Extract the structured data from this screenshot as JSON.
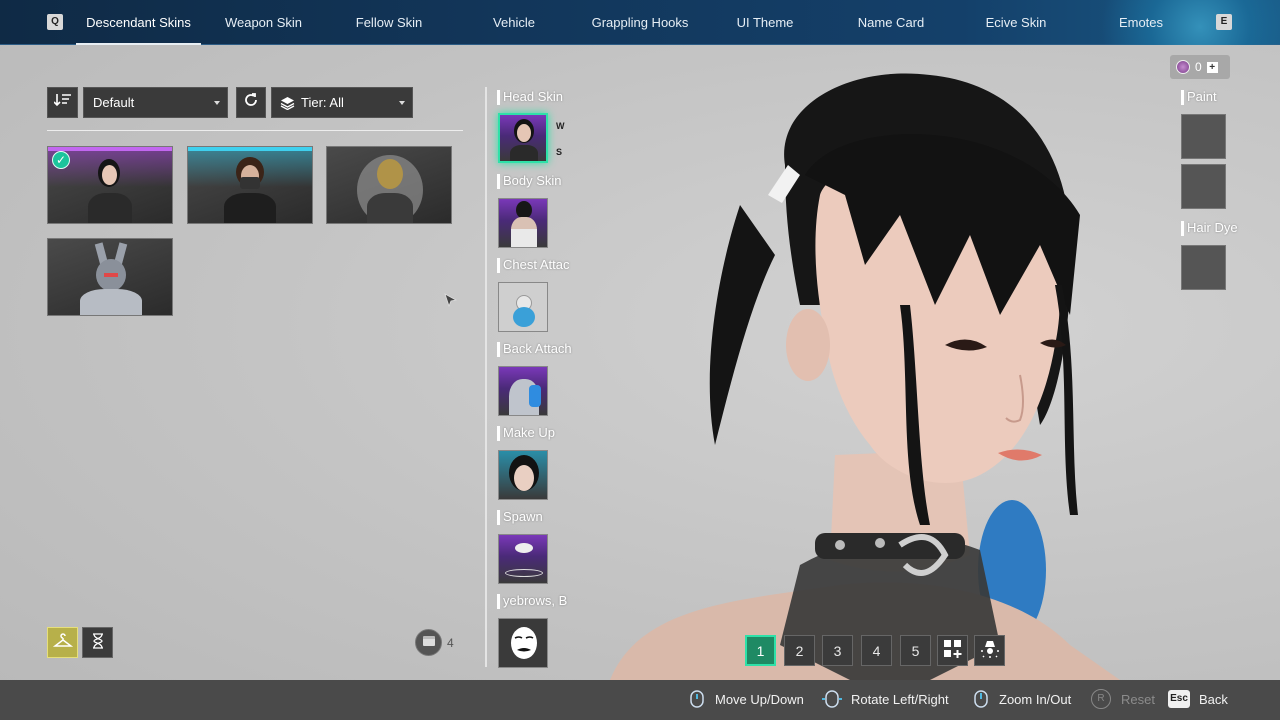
{
  "nav": {
    "prev_key": "Q",
    "next_key": "E",
    "tabs": [
      {
        "label": "Descendant Skins"
      },
      {
        "label": "Weapon Skin"
      },
      {
        "label": "Fellow Skin"
      },
      {
        "label": "Vehicle"
      },
      {
        "label": "Grappling Hooks"
      },
      {
        "label": "UI Theme"
      },
      {
        "label": "Name Card"
      },
      {
        "label": "Ecive Skin"
      },
      {
        "label": "Emotes"
      }
    ],
    "active_tab": "Descendant Skins"
  },
  "filters": {
    "sort_icon": "sort-descending-icon",
    "sort_value": "Default",
    "reset_icon": "refresh-icon",
    "tier_icon": "layers-icon",
    "tier_value": "Tier: All"
  },
  "skins": [
    {
      "name": "skin-card-1",
      "equipped": true,
      "accent": "#a23fd6"
    },
    {
      "name": "skin-card-2",
      "equipped": false,
      "accent": "#2fb9d9"
    },
    {
      "name": "skin-card-3",
      "equipped": false,
      "accent": "#6e6e6e"
    },
    {
      "name": "skin-card-4",
      "equipped": false,
      "accent": "#6e6e6e"
    }
  ],
  "bottom_left": {
    "wardrobe_icon": "hanger-icon",
    "timer_icon": "hourglass-icon",
    "storage_icon": "chest-icon",
    "storage_count": "4"
  },
  "slots": [
    {
      "label": "Head Skin",
      "tags": [
        "W",
        "S"
      ]
    },
    {
      "label": "Body Skin"
    },
    {
      "label": "Chest Attac"
    },
    {
      "label": "Back Attach"
    },
    {
      "label": "Make Up"
    },
    {
      "label": "Spawn"
    },
    {
      "label": "yebrows, B"
    }
  ],
  "currency": {
    "amount": "0",
    "plus": "+"
  },
  "side_panel": {
    "paint_label": "Paint",
    "hair_dye_label": "Hair Dye"
  },
  "presets": [
    "1",
    "2",
    "3",
    "4",
    "5"
  ],
  "active_preset": "1",
  "hints": {
    "move": "Move Up/Down",
    "rotate": "Rotate Left/Right",
    "zoom": "Zoom In/Out",
    "reset_key": "R",
    "reset": "Reset",
    "back_key": "Esc",
    "back": "Back"
  },
  "colors": {
    "accent_green": "#2ee1a8",
    "nav_bg": "#12365a",
    "purple": "#a23fd6",
    "cyan": "#2fb9d9"
  }
}
